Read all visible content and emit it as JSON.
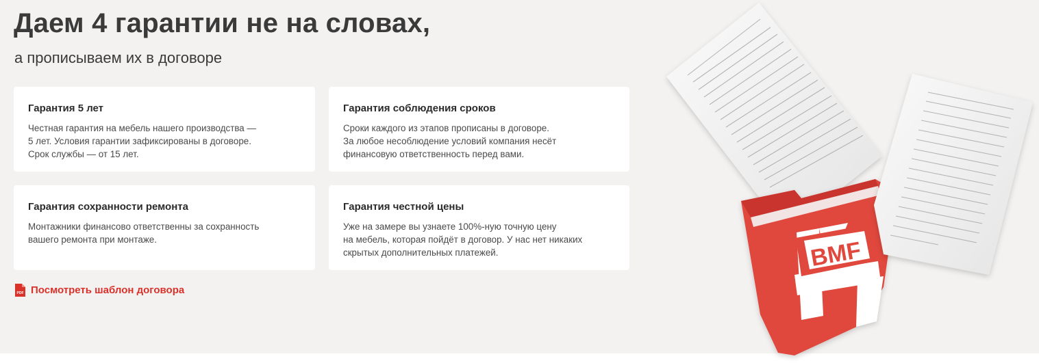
{
  "header": {
    "title": "Даем 4 гарантии не на словах,",
    "subtitle": "а прописываем их в договоре"
  },
  "cards": [
    {
      "title": "Гарантия 5 лет",
      "text": "Честная гарантия на мебель нашего производства —\n5 лет. Условия гарантии зафиксированы в договоре.\nСрок службы — от 15 лет."
    },
    {
      "title": "Гарантия соблюдения сроков",
      "text": "Сроки каждого из этапов прописаны в договоре.\nЗа любое несоблюдение условий компания несёт\nфинансовую ответственность перед вами."
    },
    {
      "title": "Гарантия сохранности ремонта",
      "text": "Монтажники финансово ответственны за сохранность\nвашего ремонта при монтаже."
    },
    {
      "title": "Гарантия честной цены",
      "text": "Уже на замере вы узнаете 100%-ную точную цену\nна мебель, которая пойдёт в договор. У нас нет никаких\nскрытых дополнительных платежей."
    }
  ],
  "contract_link": {
    "label": "Посмотреть шаблон договора",
    "icon": "pdf-file-icon",
    "icon_text": "PDF"
  },
  "illustration": {
    "logo_text": "BMF",
    "folder_color": "#e0463c",
    "accent_color": "#d8322a"
  }
}
